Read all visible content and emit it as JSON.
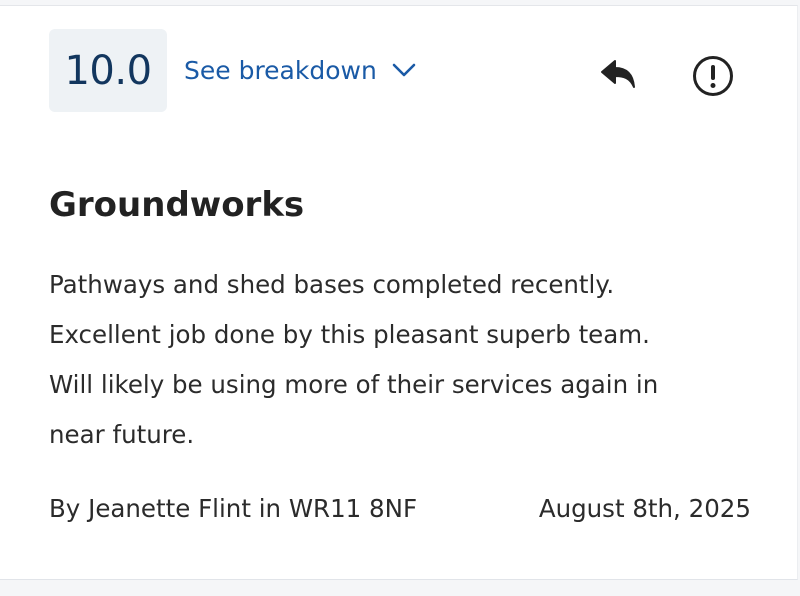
{
  "review": {
    "score": "10.0",
    "breakdown_label": "See breakdown",
    "title": "Groundworks",
    "body_lines": [
      "Pathways and shed bases completed recently.",
      "Excellent job done by this pleasant superb team.",
      "Will likely be using more of their services again in",
      "near future."
    ],
    "reviewer": "By Jeanette Flint in WR11 8NF",
    "date": "August 8th, 2025"
  },
  "icons": {
    "breakdown_toggle": "chevron-down-icon",
    "reply": "reply-arrow-icon",
    "report": "exclamation-circle-icon"
  },
  "colors": {
    "score_text": "#12365e",
    "score_background": "#eef2f5",
    "link": "#1a5aa6",
    "body_text": "#2b2b2b",
    "icon": "#222222"
  }
}
